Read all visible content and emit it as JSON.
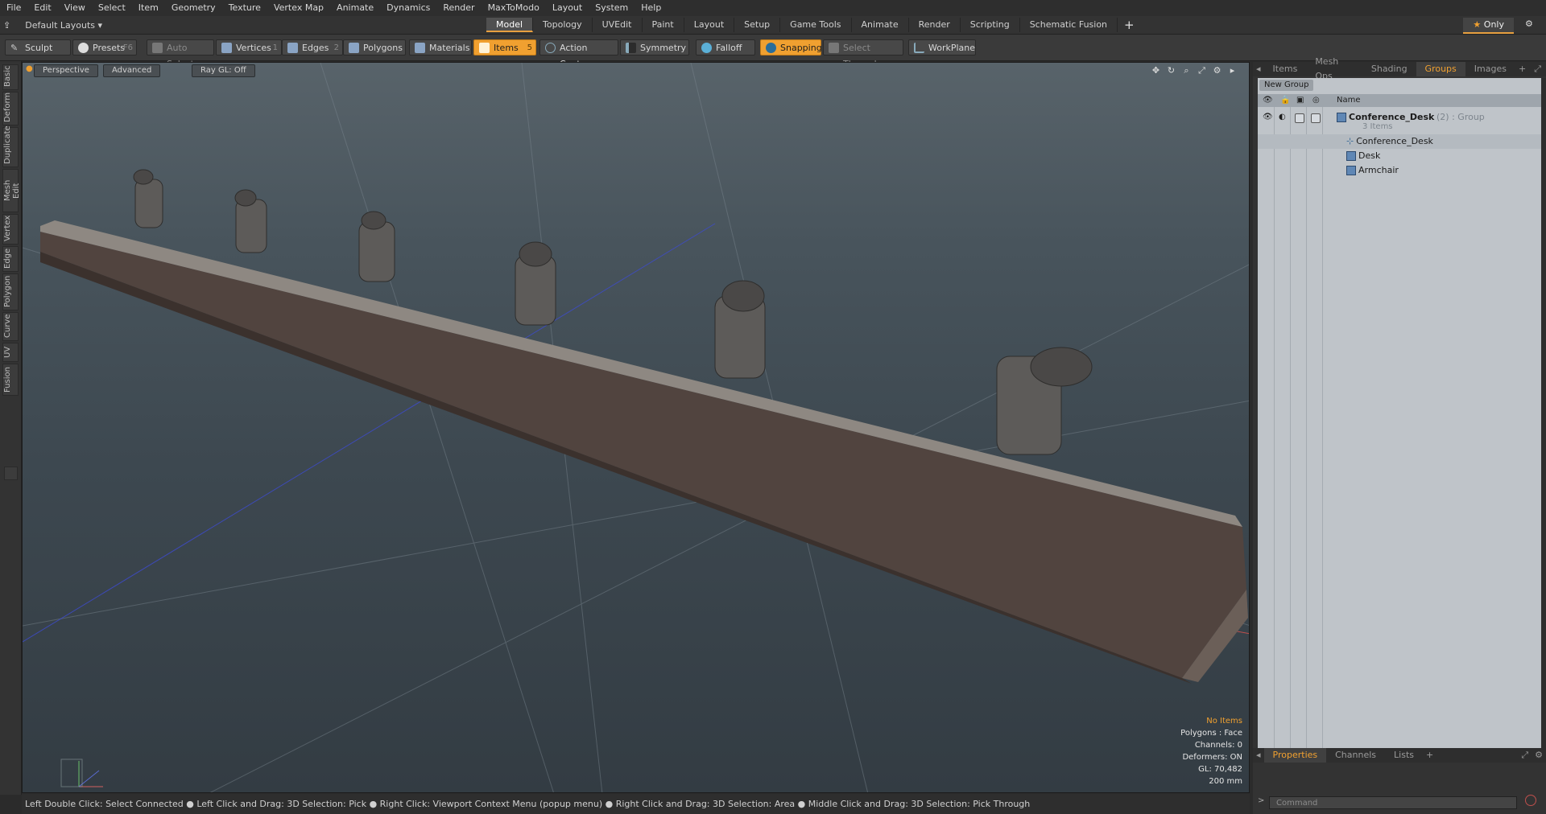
{
  "menu": [
    "File",
    "Edit",
    "View",
    "Select",
    "Item",
    "Geometry",
    "Texture",
    "Vertex Map",
    "Animate",
    "Dynamics",
    "Render",
    "MaxToModo",
    "Layout",
    "System",
    "Help"
  ],
  "layout_selector": "Default Layouts",
  "mode_tabs": [
    "Model",
    "Topology",
    "UVEdit",
    "Paint",
    "Layout",
    "Setup",
    "Game Tools",
    "Animate",
    "Render",
    "Scripting",
    "Schematic Fusion"
  ],
  "active_mode_tab": "Model",
  "only_button": "Only",
  "toolbar": {
    "sculpt": "Sculpt",
    "presets": "Presets",
    "presets_key": "F6",
    "auto_select": "Auto Select",
    "vertices": "Vertices",
    "vertices_key": "1",
    "edges": "Edges",
    "edges_key": "2",
    "polygons": "Polygons",
    "materials": "Materials",
    "items": "Items",
    "items_key": "5",
    "action_center": "Action Center",
    "symmetry": "Symmetry",
    "falloff": "Falloff",
    "snapping": "Snapping",
    "select_through": "Select Through",
    "workplane": "WorkPlane"
  },
  "left_tabs": [
    "Basic",
    "Deform",
    "Duplicate",
    "Mesh Edit",
    "Vertex",
    "Edge",
    "Polygon",
    "Curve",
    "UV",
    "Fusion"
  ],
  "viewport": {
    "view_mode": "Perspective",
    "shading": "Advanced",
    "raygl": "Ray GL: Off",
    "info": {
      "selection": "No Items",
      "polygons": "Polygons : Face",
      "channels": "Channels: 0",
      "deformers": "Deformers: ON",
      "gl": "GL: 70,482",
      "scale": "200 mm"
    }
  },
  "status": "Left Double Click: Select Connected ● Left Click and Drag: 3D Selection: Pick ● Right Click: Viewport Context Menu (popup menu) ● Right Click and Drag: 3D Selection: Area ● Middle Click and Drag: 3D Selection: Pick Through",
  "right_panel": {
    "tabs": [
      "Items",
      "Mesh Ops",
      "Shading",
      "Groups",
      "Images"
    ],
    "active_tab": "Groups",
    "new_group": "New Group",
    "column_name": "Name",
    "group_name": "Conference_Desk",
    "group_count": "(2)",
    "group_type": ": Group",
    "group_items": "3 Items",
    "children": [
      "Conference_Desk",
      "Desk",
      "Armchair"
    ]
  },
  "properties": {
    "tabs": [
      "Properties",
      "Channels",
      "Lists"
    ],
    "active_tab": "Properties",
    "command_placeholder": "Command"
  },
  "colors": {
    "accent": "#f0a030",
    "panel": "#bfc4c9",
    "viewport_top": "#58636a",
    "viewport_bottom": "#333c43"
  }
}
